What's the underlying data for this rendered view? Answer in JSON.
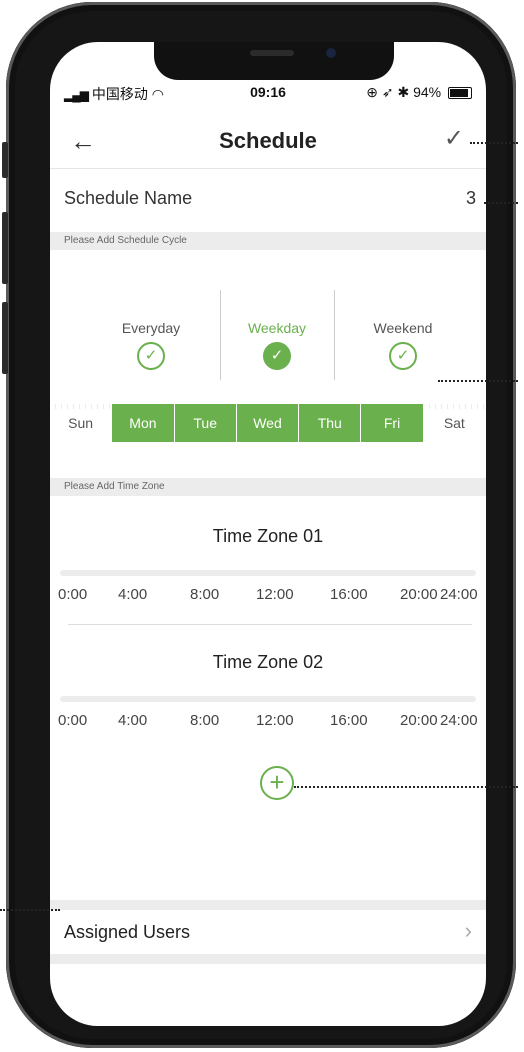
{
  "status_bar": {
    "carrier": "中国移动",
    "time": "09:16",
    "battery": "94%"
  },
  "nav": {
    "back_icon": "←",
    "title": "Schedule",
    "confirm_icon": "✓"
  },
  "schedule_name": {
    "label": "Schedule Name",
    "value": "3"
  },
  "cycle": {
    "section_label": "Please Add Schedule Cycle",
    "options": [
      {
        "label": "Everyday",
        "selected": false
      },
      {
        "label": "Weekday",
        "selected": true
      },
      {
        "label": "Weekend",
        "selected": false
      }
    ],
    "days": [
      {
        "label": "Sun",
        "selected": false
      },
      {
        "label": "Mon",
        "selected": true
      },
      {
        "label": "Tue",
        "selected": true
      },
      {
        "label": "Wed",
        "selected": true
      },
      {
        "label": "Thu",
        "selected": true
      },
      {
        "label": "Fri",
        "selected": true
      },
      {
        "label": "Sat",
        "selected": false
      }
    ]
  },
  "time_zones": {
    "section_label": "Please Add Time Zone",
    "zones": [
      {
        "title": "Time Zone 01"
      },
      {
        "title": "Time Zone 02"
      }
    ],
    "ticks": [
      "0:00",
      "4:00",
      "8:00",
      "12:00",
      "16:00",
      "20:00",
      "24:00"
    ],
    "add_icon": "+"
  },
  "assigned_users": {
    "label": "Assigned Users",
    "chevron": "›"
  },
  "colors": {
    "accent": "#6ab04c"
  }
}
